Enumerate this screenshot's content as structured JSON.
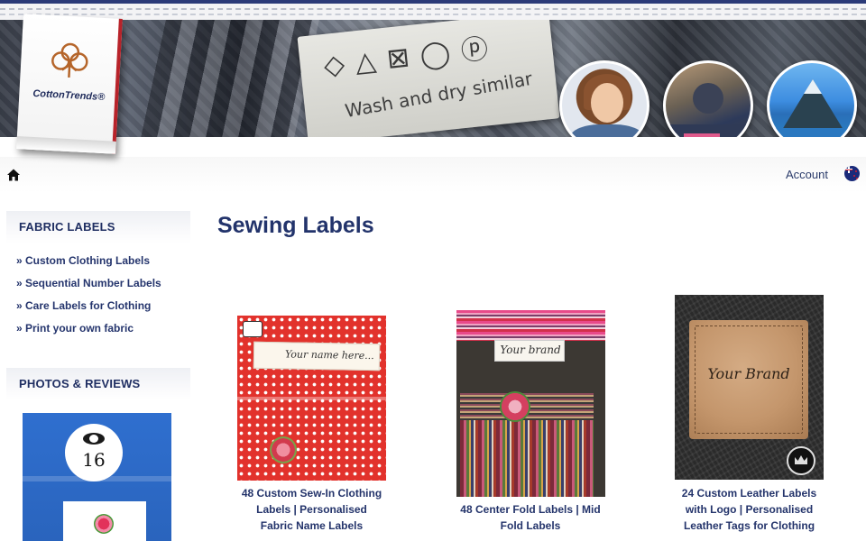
{
  "site": {
    "logo_text": "CottonTrends®",
    "banner_tag_text": "Wash and dry similar"
  },
  "nav": {
    "home_icon": "home-icon",
    "account_label": "Account",
    "flag_icon": "nz-flag-icon"
  },
  "sidebar": {
    "fabric_labels": {
      "title": "FABRIC LABELS",
      "items": [
        {
          "label": "» Custom Clothing Labels"
        },
        {
          "label": "» Sequential Number Labels"
        },
        {
          "label": "» Care Labels for Clothing"
        },
        {
          "label": "» Print your own fabric"
        }
      ]
    },
    "photos_reviews": {
      "title": "PHOTOS & REVIEWS",
      "photo_number": "16"
    }
  },
  "main": {
    "title": "Sewing Labels",
    "products": [
      {
        "caption_lines": [
          "48 Custom Sew-In Clothing",
          "Labels | Personalised",
          "Fabric Name Labels"
        ],
        "image_text": "Your name here..."
      },
      {
        "caption_lines": [
          "48 Center Fold Labels | Mid",
          "Fold Labels"
        ],
        "image_text": "Your brand"
      },
      {
        "caption_lines": [
          "24 Custom Leather Labels",
          "with Logo | Personalised",
          "Leather Tags for Clothing"
        ],
        "image_text": "Your Brand"
      }
    ]
  },
  "colors": {
    "navy": "#22336b",
    "link": "#25356d",
    "brand_red": "#b8232a"
  }
}
